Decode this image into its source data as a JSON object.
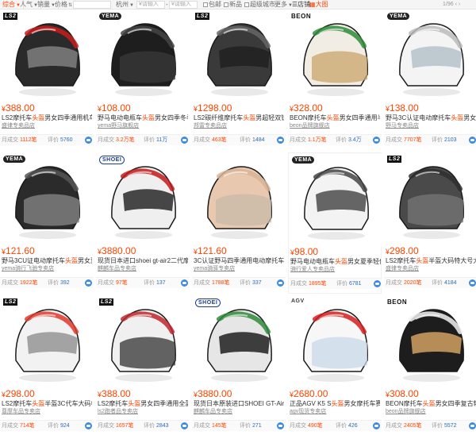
{
  "filter_bar": {
    "sorts": [
      {
        "label": "综合",
        "active": true
      },
      {
        "label": "人气",
        "active": false
      },
      {
        "label": "销量",
        "active": false
      },
      {
        "label": "价格",
        "active": false
      }
    ],
    "location": "杭州",
    "price_min_placeholder": "¥请输入",
    "price_max_placeholder": "¥请输入",
    "checks": [
      "包邮",
      "新品",
      "超级城市"
    ],
    "more": "更多",
    "views": [
      {
        "label": "店铺",
        "active": false
      },
      {
        "label": "大图",
        "active": true
      }
    ],
    "pager": "1/96"
  },
  "products": [
    {
      "price": "388.00",
      "title_pre": "LS2摩托车",
      "title_hl": "头盔",
      "title_post": "男女四季通用机车防霧",
      "shop": "盛律专卖品店",
      "sales": "1112笔",
      "reviews": "5760",
      "brand": "LS2",
      "color": "#2a2a2a",
      "accent": "#c91c1c",
      "visor": "#7a7a7a"
    },
    {
      "price": "108.00",
      "title_pre": "野马电动电瓶车",
      "title_hl": "头盔",
      "title_post": "男女四季冬季轻便式半",
      "shop": "yema野马旗舰店",
      "sales": "3.2万笔",
      "reviews": "11万",
      "brand": "YEMA",
      "color": "#1e1e1e",
      "accent": "#444",
      "visor": "#3a3a3a"
    },
    {
      "price": "1298.00",
      "title_pre": "LS2碳纤维摩托车",
      "title_hl": "头盔",
      "title_post": "男超轻双镜片气旗",
      "shop": "邦雷专卖品店",
      "sales": "463笔",
      "reviews": "1484",
      "brand": "LS2",
      "color": "#3a3a3a",
      "accent": "#666",
      "visor": "#222"
    },
    {
      "price": "328.00",
      "title_pre": "BEON摩托车",
      "title_hl": "头盔",
      "title_post": "男女四季通用半盔电动车",
      "shop": "beon品牌旗舰店",
      "sales": "1.1万笔",
      "reviews": "3.4万",
      "brand": "BEON",
      "color": "#f2ede4",
      "accent": "#2e8b3a",
      "visor": "#c9a46a"
    },
    {
      "price": "138.00",
      "title_pre": "野马3C认证电动摩托车",
      "title_hl": "头盔",
      "title_post": "男女夏季",
      "shop": "野马专卖品店",
      "sales": "7707笔",
      "reviews": "2103",
      "brand": "YEMA",
      "color": "#f4f4f4",
      "accent": "#bbb",
      "visor": "#b8c4cc"
    },
    {
      "price": "121.60",
      "title_pre": "野马3CU证电动摩托车",
      "title_hl": "头盔",
      "title_post": "男女夏季",
      "shop": "yema骑行飞驰专卖店",
      "sales": "1922笔",
      "reviews": "392",
      "brand": "YEMA",
      "color": "#2b2b2b",
      "accent": "#555",
      "visor": "#8a8a8a"
    },
    {
      "price": "3880.00",
      "title_pre": "现货日本进口shoei gt-air2二代摩托车",
      "title_hl": "",
      "title_post": "",
      "shop": "麒麟车品专卖店",
      "sales": "97笔",
      "reviews": "137",
      "brand": "SHOEI",
      "color": "#efefef",
      "accent": "#c41a1a",
      "visor": "#333"
    },
    {
      "price": "121.60",
      "title_pre": "3C认证野马四季通用电动摩托车",
      "title_hl": "头盔",
      "title_post": "",
      "shop": "yema骑驿专卖店",
      "sales": "1788笔",
      "reviews": "337",
      "brand": "",
      "color": "#e8c9b0",
      "accent": "#d9b394",
      "visor": "#c8b8a8"
    },
    {
      "price": "98.00",
      "title_pre": "野马电动电瓶车",
      "title_hl": "头盔",
      "title_post": "男女夏季轻便式双",
      "shop": "骑行爱人专卖品店",
      "sales": "1895笔",
      "reviews": "6781",
      "brand": "YEMA",
      "color": "#f3f3f3",
      "accent": "#444",
      "visor": "#555"
    },
    {
      "price": "298.00",
      "title_pre": "LS2摩托车",
      "title_hl": "头盔",
      "title_post": "半盔大码特大号大",
      "shop": "盛律专卖品店",
      "sales": "2020笔",
      "reviews": "4184",
      "brand": "LS2",
      "color": "#4a4a4a",
      "accent": "#2f2f2f",
      "visor": "#777"
    },
    {
      "price": "298.00",
      "title_pre": "LS2摩托车",
      "title_hl": "头盔",
      "title_post": "半盔3C代车大码电动车",
      "shop": "尊摩车品专卖店",
      "sales": "714笔",
      "reviews": "924",
      "brand": "LS2",
      "color": "#f2f2f2",
      "accent": "#e03a2a",
      "visor": "#9a9a9a"
    },
    {
      "price": "388.00",
      "title_pre": "LS2摩托车",
      "title_hl": "头盔",
      "title_post": "男女四季通用全盔",
      "shop": "ls2跑者品专卖店",
      "sales": "1657笔",
      "reviews": "2843",
      "brand": "LS2",
      "color": "#f0f0f0",
      "accent": "#c0262d",
      "visor": "#333"
    },
    {
      "price": "3880.00",
      "title_pre": "现货日本原装进口SHOEI GT-Air2 INE",
      "title_hl": "",
      "title_post": "",
      "shop": "麒麟车品专卖店",
      "sales": "145笔",
      "reviews": "271",
      "brand": "SHOEI",
      "color": "#e6e6e6",
      "accent": "#2f8a3a",
      "visor": "#2a2a2a"
    },
    {
      "price": "2680.00",
      "title_pre": "正品AGV K5 S",
      "title_hl": "头盔",
      "title_post": "男女摩托车赛车全",
      "shop": "agv现货专卖店",
      "sales": "490笔",
      "reviews": "426",
      "brand": "AGV",
      "color": "#f7f7f7",
      "accent": "#d61d1d",
      "visor": "#c8d8e8"
    },
    {
      "price": "308.00",
      "title_pre": "BEON摩托车",
      "title_hl": "头盔",
      "title_post": "男女四季复古轻便",
      "shop": "beon品牌旗舰店",
      "sales": "2405笔",
      "reviews": "5572",
      "brand": "BEON",
      "color": "#1d1d1d",
      "accent": "#f2f2f2",
      "visor": "#c99a5e"
    }
  ],
  "labels": {
    "sales_prefix": "月成交",
    "reviews_prefix": "评价",
    "currency": "¥"
  }
}
